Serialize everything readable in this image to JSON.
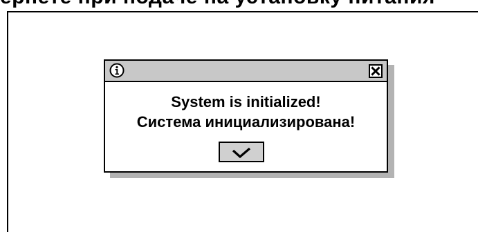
{
  "top_fragment_text": "ернете при подаче на установку питания",
  "dialog": {
    "title_icon": "info-icon",
    "close_icon": "close-icon",
    "message_line1": "System is initialized!",
    "message_line2": "Система инициализирована!",
    "ok_icon": "checkmark-icon"
  },
  "colors": {
    "titlebar": "#c8c8c8",
    "button": "#d0d0d0",
    "shadow": "#b3b3b3",
    "border": "#000000"
  }
}
